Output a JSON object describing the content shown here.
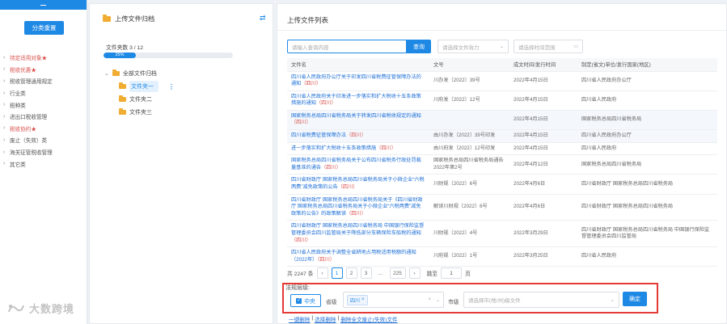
{
  "sidebar": {
    "reset_label": "分类重置",
    "items": [
      {
        "label": "待定适用对象★",
        "red": true
      },
      {
        "label": "税收优惠★",
        "red": true
      },
      {
        "label": "税收管理通用规定",
        "red": false
      },
      {
        "label": "行业类",
        "red": false
      },
      {
        "label": "税种类",
        "red": false
      },
      {
        "label": "进出口税收管理",
        "red": false
      },
      {
        "label": "税收协约★",
        "red": true
      },
      {
        "label": "废止（失效）类",
        "red": false
      },
      {
        "label": "海关征管税收管理",
        "red": false
      },
      {
        "label": "其它类",
        "red": false
      }
    ]
  },
  "watermark": "大数跨境",
  "archive": {
    "title": "上传文件归档",
    "count_text": "文件夹数 3 / 12",
    "progress_label": "25%",
    "progress_fraction": 0.25,
    "root_label": "全部文件归档",
    "folders": [
      "文件夹一",
      "文件夹二",
      "文件夹三"
    ]
  },
  "main": {
    "title": "上传文件列表",
    "search_placeholder": "请输入查询内容",
    "search_label": "查询",
    "validity_placeholder": "请选择文件效力",
    "date_placeholder": "请选择时间范围",
    "columns": [
      "文件名",
      "文号",
      "成文时间/发行时间",
      "制定(省文)单位/发行国家(地区)"
    ],
    "rows": [
      {
        "name": "四川省人民政府办公厅关于印发四川省税费征管保障办法的通知",
        "tag": "（四川）",
        "num": "川办发〔2022〕39号",
        "date": "2022年4月15日",
        "org": "四川省人民政府办公厅",
        "hl": false
      },
      {
        "name": "四川省人民政府关于印发进一步落实和扩大税收十五条政策措施的通知",
        "tag": "（四川）",
        "num": "川府发〔2022〕12号",
        "date": "2022年4月15日",
        "org": "四川省人民政府",
        "hl": false
      },
      {
        "name": "国家税务总局四川省税务局关于转发四川省税收规定的通知",
        "tag": "（四川）",
        "num": "",
        "date": "2022年4月15日",
        "org": "国家税务总局四川省税务局",
        "hl": true
      },
      {
        "name": "四川省税费征管保障办法",
        "tag": "（四川）",
        "num": "由川办发〔2022〕39号印发",
        "date": "2022年4月15日",
        "org": "四川省人民政府办公厅",
        "hl": true
      },
      {
        "name": "进一步落实和扩大税收十五条政策措施",
        "tag": "（四川）",
        "num": "由川府发〔2022〕12号印发",
        "date": "2022年4月15日",
        "org": "四川省人民政府",
        "hl": false
      },
      {
        "name": "国家税务总局四川省税务局关于公布四川省税务行政处罚裁量基准的通告",
        "tag": "（四川）",
        "num": "国家税务总局四川省税务局通告2022年第2号",
        "date": "2022年4月12日",
        "org": "国家税务总局四川省税务局",
        "hl": false
      },
      {
        "name": "四川省财政厅 国家税务总局四川省税务局关于小微企业“六税两费”减免政策的公告",
        "tag": "（四川）",
        "num": "川财规〔2022〕6号",
        "date": "2022年4月6日",
        "org": "四川省财政厅 国家税务总局四川省税务局",
        "hl": false
      },
      {
        "name": "四川省财政厅 国家税务总局四川省税务局关于《四川省财政厅 国家税务总局四川省税务局关于小微企业“六税两费”减免政策的公告》的政策解读",
        "tag": "（四川）",
        "num": "解读川财规〔2022〕6号",
        "date": "2022年4月6日",
        "org": "四川省财政厅 国家税务总局四川省税务局",
        "hl": false
      },
      {
        "name": "四川省财政厅 国家税务总局四川省税务局 中国银行保险监督管理委员会四川监管局关于降低部分车辆保险车船税的通知",
        "tag": "（四川）",
        "num": "川财规〔2022〕4号",
        "date": "2022年3月29日",
        "org": "四川省财政厅 国家税务总局四川省税务局 中国银行保险监督管理委员会四川监管局",
        "hl": false
      },
      {
        "name": "四川省人民政府关于调整全省耕地占用税适用税额的通知（2022年）",
        "tag": "（四川）",
        "num": "川府规〔2022〕1号",
        "date": "2022年3月25日",
        "org": "四川省人民政府",
        "hl": false
      }
    ],
    "pager": {
      "total_text": "共 2247 条",
      "prev": "‹",
      "pages": [
        "1",
        "2",
        "3",
        "...",
        "225"
      ],
      "next": "›",
      "jump_label": "跳至",
      "jump_value": "1",
      "page_unit": "页"
    },
    "law": {
      "label": "法规层级:",
      "central_label": "中央",
      "province_label": "省级",
      "province_chip": "四川",
      "city_label": "市级",
      "city_placeholder": "请选择市(地/州)级文件",
      "confirm_label": "确定"
    },
    "bottom": {
      "delete_all": "一键删除",
      "select_delete": "选择删除",
      "delete_void": "删除全文废止(失效)文件"
    }
  }
}
